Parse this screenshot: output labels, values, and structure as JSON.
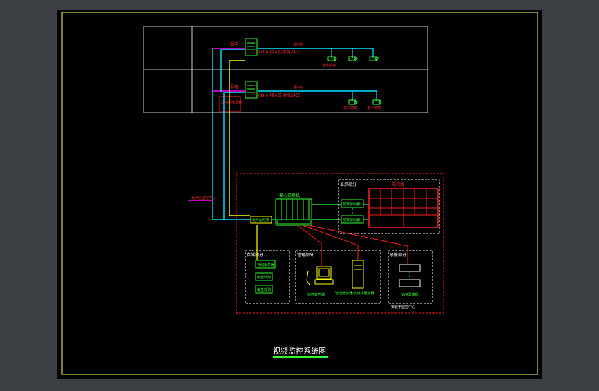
{
  "title": "视频监控系统图",
  "floor_labels": {
    "sw1": "弱电",
    "sw2": "弱电",
    "enc1": "8Dro 接入交换机24口",
    "enc2": "8Dro 接入交换机24口",
    "link1": "超5类",
    "link2": "超5类",
    "cam_a": "室外前端",
    "cam_b": "第二前端",
    "cam_c": "第一前端",
    "ups": "弱电间电源箱",
    "fiber": "光纤至监控中心"
  },
  "center": {
    "core_switch": "核心交换机",
    "fiber_box": "光纤配线架",
    "display_area": "显示部分",
    "tv_wall": "电视墙",
    "decoder1": "视频解码器",
    "decoder2": "视频解码器",
    "storage_area": "存储部分",
    "stor1": "存储服务器",
    "stor2": "磁盘阵列",
    "stor3": "磁盘阵列",
    "manage_area": "管理部分",
    "pc_label": "监控客户端",
    "server_label": "管理服务器/流媒体服务器",
    "record_area": "录像部分",
    "rec_label": "NVR录像机",
    "rec_note": "安装于监控中心"
  },
  "colors": {
    "cyan": "#00e5ff",
    "magenta": "#ff00ff",
    "yellow": "#ffff00",
    "green": "#33ff33",
    "red": "#ff2020",
    "white": "#ffffff"
  }
}
